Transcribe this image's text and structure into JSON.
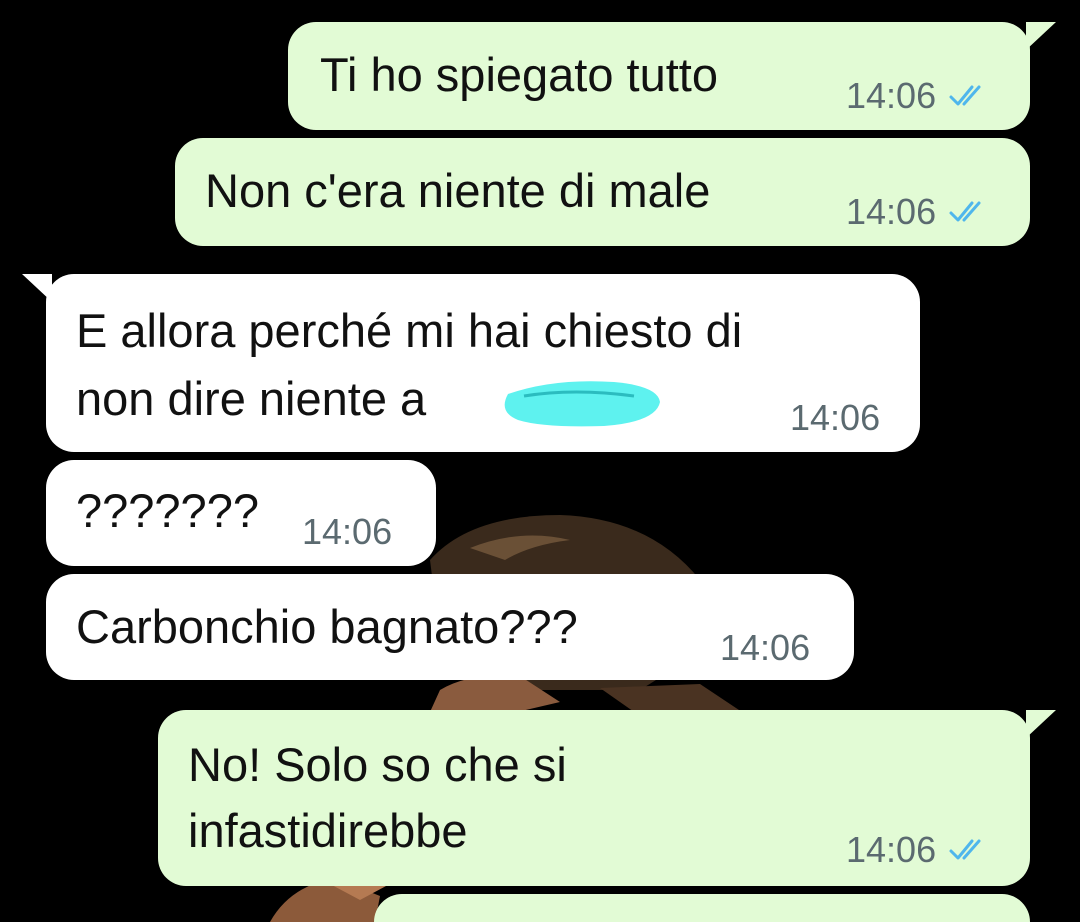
{
  "colors": {
    "background": "#000000",
    "outgoing_bubble": "#e2fbd5",
    "incoming_bubble": "#ffffff",
    "read_ticks": "#4fb6ec",
    "redaction": "#5ef2ef"
  },
  "messages": [
    {
      "direction": "outgoing",
      "lines": [
        "Ti ho spiegato tutto"
      ],
      "time": "14:06",
      "status": "read",
      "status_icon": "double-check-icon"
    },
    {
      "direction": "outgoing",
      "lines": [
        "Non c'era niente di male"
      ],
      "time": "14:06",
      "status": "read",
      "status_icon": "double-check-icon"
    },
    {
      "direction": "incoming",
      "lines": [
        "E allora perché mi hai chiesto di",
        "non dire niente a"
      ],
      "time": "14:06",
      "redacted": true
    },
    {
      "direction": "incoming",
      "lines": [
        "???????"
      ],
      "time": "14:06"
    },
    {
      "direction": "incoming",
      "lines": [
        "Carbonchio bagnato???"
      ],
      "time": "14:06"
    },
    {
      "direction": "outgoing",
      "lines": [
        "No! Solo so che si",
        "infastidirebbe"
      ],
      "time": "14:06",
      "status": "read",
      "status_icon": "double-check-icon"
    }
  ]
}
